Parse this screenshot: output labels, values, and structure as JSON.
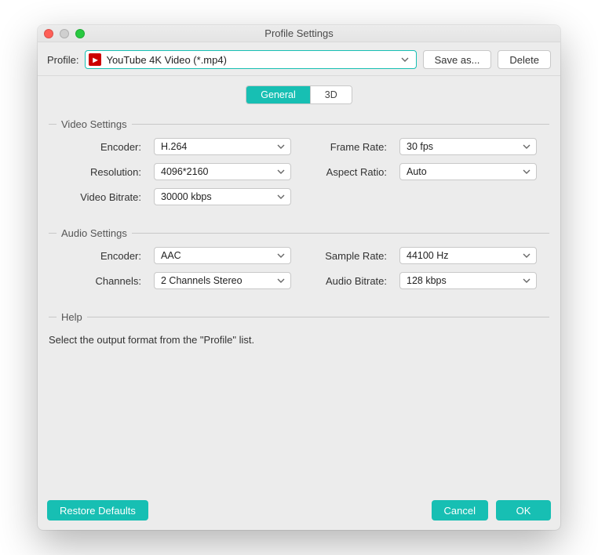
{
  "window": {
    "title": "Profile Settings"
  },
  "toolbar": {
    "profile_label": "Profile:",
    "profile_value": "YouTube 4K Video (*.mp4)",
    "save_as": "Save as...",
    "delete": "Delete"
  },
  "tabs": {
    "general": "General",
    "three_d": "3D",
    "active": "general"
  },
  "video": {
    "heading": "Video Settings",
    "encoder_label": "Encoder:",
    "encoder": "H.264",
    "resolution_label": "Resolution:",
    "resolution": "4096*2160",
    "bitrate_label": "Video Bitrate:",
    "bitrate": "30000 kbps",
    "framerate_label": "Frame Rate:",
    "framerate": "30 fps",
    "aspect_label": "Aspect Ratio:",
    "aspect": "Auto"
  },
  "audio": {
    "heading": "Audio Settings",
    "encoder_label": "Encoder:",
    "encoder": "AAC",
    "channels_label": "Channels:",
    "channels": "2 Channels Stereo",
    "samplerate_label": "Sample Rate:",
    "samplerate": "44100 Hz",
    "bitrate_label": "Audio Bitrate:",
    "bitrate": "128 kbps"
  },
  "help": {
    "heading": "Help",
    "text": "Select the output format from the \"Profile\" list."
  },
  "footer": {
    "restore": "Restore Defaults",
    "cancel": "Cancel",
    "ok": "OK"
  },
  "colors": {
    "accent": "#17bfb3"
  }
}
